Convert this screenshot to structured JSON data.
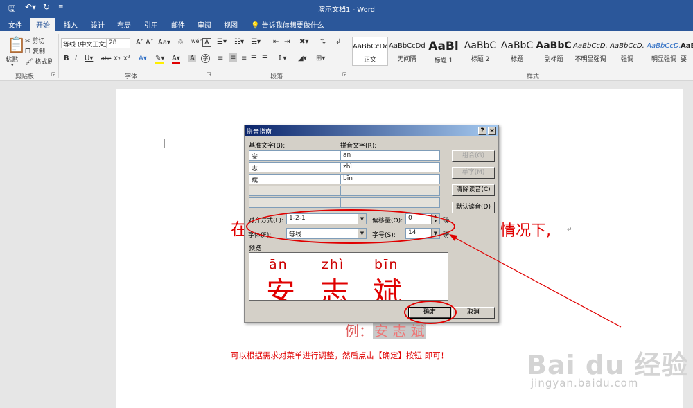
{
  "window": {
    "title": "演示文档1 - Word"
  },
  "tabs": [
    "文件",
    "开始",
    "插入",
    "设计",
    "布局",
    "引用",
    "邮件",
    "审阅",
    "视图"
  ],
  "tell_me": "告诉我你想要做什么",
  "clipboard": {
    "paste": "粘贴",
    "cut": "剪切",
    "copy": "复制",
    "format_painter": "格式刷",
    "label": "剪贴板"
  },
  "font_group": {
    "font_name": "等线 (中文正文)",
    "font_size": "28",
    "label": "字体"
  },
  "paragraph_group": {
    "label": "段落"
  },
  "styles_group": {
    "label": "样式",
    "items": [
      {
        "sample": "AaBbCcDd",
        "name": "正文"
      },
      {
        "sample": "AaBbCcDd",
        "name": "无间隔"
      },
      {
        "sample": "AaBl",
        "name": "标题 1"
      },
      {
        "sample": "AaBbC",
        "name": "标题 2"
      },
      {
        "sample": "AaBbC",
        "name": "标题"
      },
      {
        "sample": "AaBbC",
        "name": "副标题"
      },
      {
        "sample": "AaBbCcD.",
        "name": "不明显强调"
      },
      {
        "sample": "AaBbCcD.",
        "name": "强调"
      },
      {
        "sample": "AaBbCcD.",
        "name": "明显强调"
      },
      {
        "sample": "AaB",
        "name": "要"
      }
    ]
  },
  "dialog": {
    "title": "拼音指南",
    "help": "?",
    "close": "×",
    "base_label": "基准文字(B):",
    "ruby_label": "拼音文字(R):",
    "rows": [
      {
        "base": "安",
        "ruby": "ān"
      },
      {
        "base": "志",
        "ruby": "zhì"
      },
      {
        "base": "斌",
        "ruby": "bīn"
      },
      {
        "base": "",
        "ruby": ""
      },
      {
        "base": "",
        "ruby": ""
      }
    ],
    "buttons": {
      "group": "组合(G)",
      "mono": "单字(M)",
      "clear": "清除读音(C)",
      "default": "默认读音(D)",
      "ok": "确定",
      "cancel": "取消"
    },
    "alignment_label": "对齐方式(L):",
    "alignment_value": "1-2-1",
    "offset_label": "偏移量(O):",
    "offset_value": "0",
    "offset_unit": "磅",
    "font_label": "字体(F):",
    "font_value": "等线",
    "size_label": "字号(S):",
    "size_value": "14",
    "size_unit": "磅",
    "preview_label": "预览",
    "preview_pinyin": [
      "ān",
      "zhì",
      "bīn"
    ],
    "preview_chars": [
      "安",
      "志",
      "斌"
    ]
  },
  "document": {
    "line1_left": "在",
    "line1_right": "情况下,",
    "example_prefix": "例：",
    "example_chars": "安 志 斌",
    "instruction": "可以根据需求对菜单进行调整，然后点击【确定】按钮 即可！",
    "para_mark": "↵"
  },
  "watermark": {
    "brand": "Bai du 经验",
    "url": "jingyan.baidu.com"
  },
  "colors": {
    "word_blue": "#2b579a",
    "annotation_red": "#e00000"
  }
}
